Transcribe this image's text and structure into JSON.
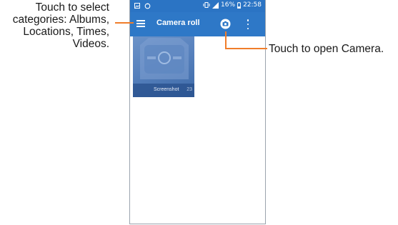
{
  "status_bar": {
    "left_icons": [
      "image-icon",
      "sync-icon"
    ],
    "battery": "16%",
    "time": "22:58"
  },
  "app_bar": {
    "title": "Camera roll",
    "menu_icon": "hamburger-menu-icon",
    "camera_icon": "camera-icon",
    "more_icon": "more-vert-icon"
  },
  "albums": [
    {
      "label": "Screenshot",
      "count": "23"
    }
  ],
  "callouts": {
    "left_lines": [
      "Touch to select",
      "categories: Albums,",
      "Locations, Times,",
      "Videos."
    ],
    "right": "Touch to open Camera."
  },
  "colors": {
    "app_bar": "#2e78c7",
    "callout_line": "#f07d2a"
  }
}
